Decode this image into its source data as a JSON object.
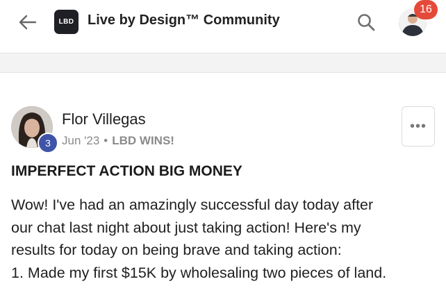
{
  "header": {
    "back_icon": "arrow-left-icon",
    "logo_text": "LBD",
    "title": "Live by Design™ Community",
    "search_icon": "search-icon",
    "notification_count": "16"
  },
  "post": {
    "author_name": "Flor Villegas",
    "level": "3",
    "date": "Jun '23",
    "separator": "•",
    "category": "LBD WINS!",
    "more_icon": "more-horizontal-icon",
    "more_label": "•••",
    "title": "IMPERFECT ACTION BIG MONEY",
    "body_lines": [
      "Wow! I've had an amazingly successful day today after",
      "our chat last night about just taking action! Here's my",
      "results for today on being brave and taking action:",
      "1. Made my first $15K by wholesaling two pieces of land."
    ]
  },
  "colors": {
    "notification_badge": "#e5493a",
    "level_badge": "#3f54a8",
    "logo_background": "#1f1f26"
  }
}
